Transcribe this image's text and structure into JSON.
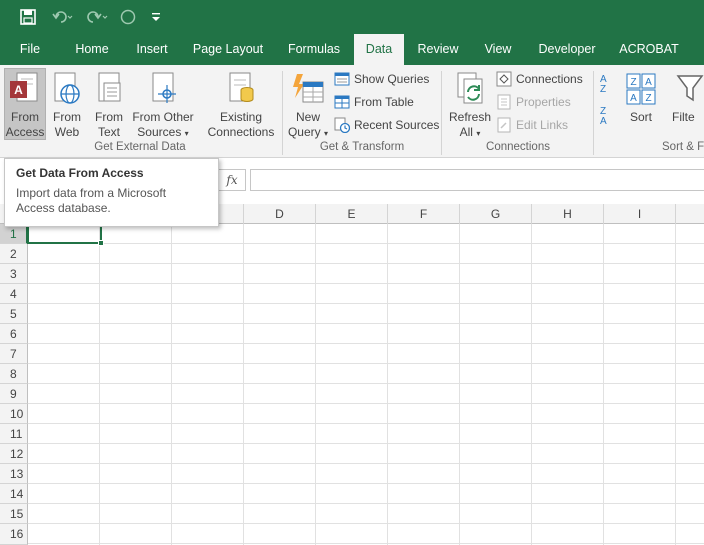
{
  "qat": {
    "save_icon": "save-icon",
    "undo_icon": "undo-icon",
    "redo_icon": "redo-icon",
    "touch_icon": "touch-mode-icon",
    "customize_icon": "customize-qat-icon"
  },
  "tabs": [
    "File",
    "Home",
    "Insert",
    "Page Layout",
    "Formulas",
    "Data",
    "Review",
    "View",
    "Developer",
    "ACROBAT"
  ],
  "active_tab": "Data",
  "ribbon": {
    "get_external_data": {
      "label": "Get External Data",
      "from_access": [
        "From",
        "Access"
      ],
      "from_web": [
        "From",
        "Web"
      ],
      "from_text": [
        "From",
        "Text"
      ],
      "from_other": [
        "From Other",
        "Sources"
      ],
      "existing": [
        "Existing",
        "Connections"
      ]
    },
    "get_transform": {
      "label": "Get & Transform",
      "new_query": [
        "New",
        "Query"
      ],
      "show_queries": "Show Queries",
      "from_table": "From Table",
      "recent_sources": "Recent Sources"
    },
    "connections": {
      "label": "Connections",
      "refresh_all": [
        "Refresh",
        "All"
      ],
      "connections": "Connections",
      "properties": "Properties",
      "edit_links": "Edit Links"
    },
    "sort_filter": {
      "label": "Sort & F",
      "sort": "Sort",
      "filter": "Filte",
      "az": "A Z",
      "za": "Z A"
    }
  },
  "tooltip": {
    "title": "Get Data From Access",
    "description": "Import data from a Microsoft Access database."
  },
  "formula_bar": {
    "fx": "fx",
    "value": ""
  },
  "columns": [
    "D",
    "E",
    "F",
    "G",
    "H",
    "I"
  ],
  "rows": [
    "1",
    "2",
    "3",
    "4",
    "5",
    "6",
    "7",
    "8",
    "9",
    "10",
    "11",
    "12",
    "13",
    "14",
    "15",
    "16"
  ],
  "selected_row": "1",
  "colors": {
    "brand": "#217346",
    "ribbon_bg": "#f3f3f3",
    "access_red": "#a4373a"
  }
}
